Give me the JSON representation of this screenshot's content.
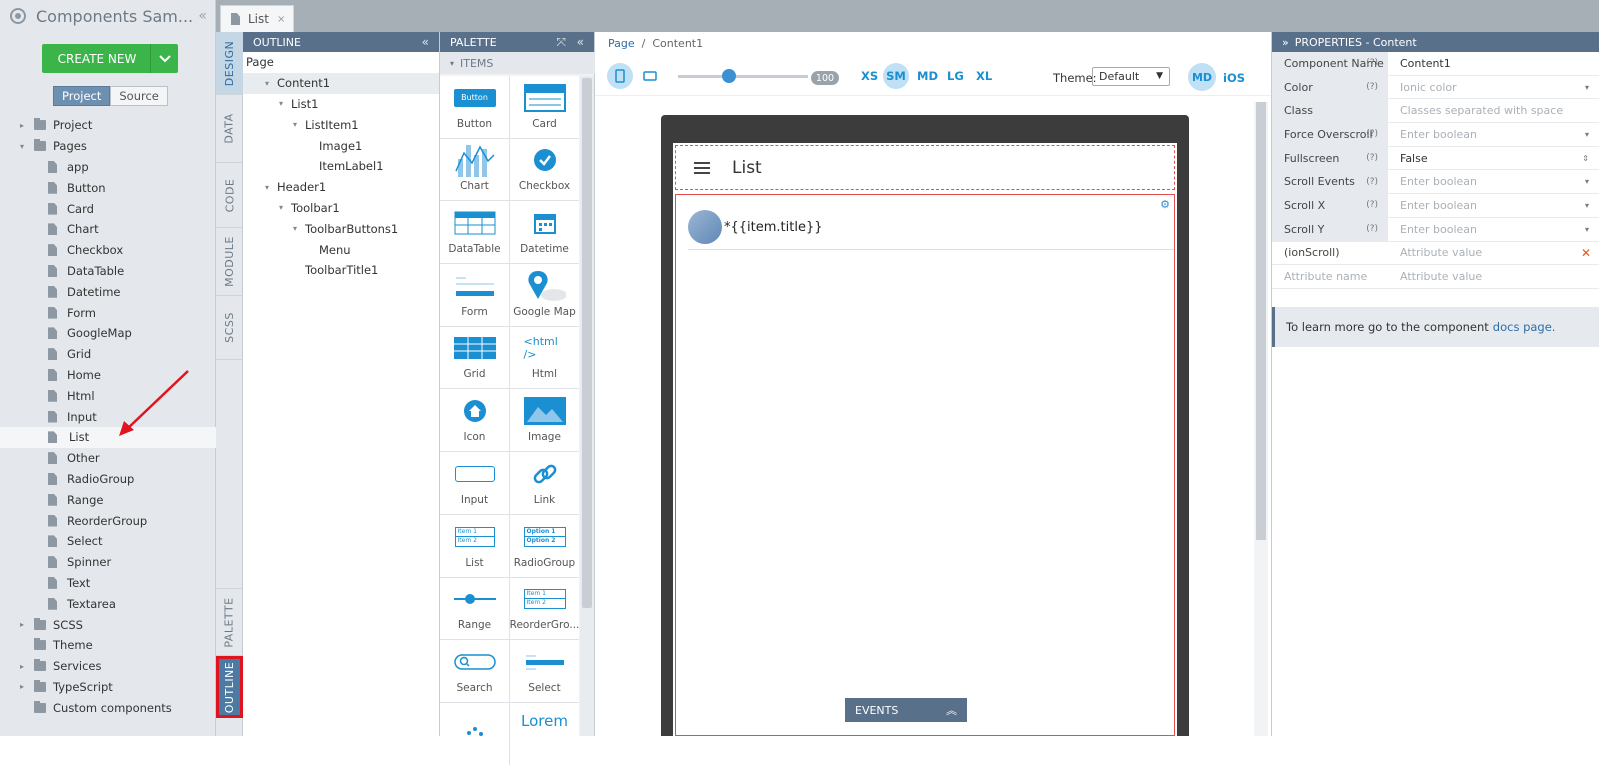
{
  "project": {
    "title": "Components Sam...",
    "create_label": "CREATE NEW",
    "tabs": [
      "Project",
      "Source"
    ],
    "tree": [
      {
        "label": "Project",
        "type": "folder",
        "level": 0,
        "toggle": "▸"
      },
      {
        "label": "Pages",
        "type": "folder",
        "level": 0,
        "toggle": "▾"
      },
      {
        "label": "app",
        "type": "page",
        "level": 1
      },
      {
        "label": "Button",
        "type": "page",
        "level": 1
      },
      {
        "label": "Card",
        "type": "page",
        "level": 1
      },
      {
        "label": "Chart",
        "type": "page",
        "level": 1
      },
      {
        "label": "Checkbox",
        "type": "page",
        "level": 1
      },
      {
        "label": "DataTable",
        "type": "page",
        "level": 1
      },
      {
        "label": "Datetime",
        "type": "page",
        "level": 1
      },
      {
        "label": "Form",
        "type": "page",
        "level": 1
      },
      {
        "label": "GoogleMap",
        "type": "page",
        "level": 1
      },
      {
        "label": "Grid",
        "type": "page",
        "level": 1
      },
      {
        "label": "Home",
        "type": "page",
        "level": 1
      },
      {
        "label": "Html",
        "type": "page",
        "level": 1
      },
      {
        "label": "Input",
        "type": "page",
        "level": 1
      },
      {
        "label": "List",
        "type": "page",
        "level": 1,
        "selected": true
      },
      {
        "label": "Other",
        "type": "page",
        "level": 1
      },
      {
        "label": "RadioGroup",
        "type": "page",
        "level": 1
      },
      {
        "label": "Range",
        "type": "page",
        "level": 1
      },
      {
        "label": "ReorderGroup",
        "type": "page",
        "level": 1
      },
      {
        "label": "Select",
        "type": "page",
        "level": 1
      },
      {
        "label": "Spinner",
        "type": "page",
        "level": 1
      },
      {
        "label": "Text",
        "type": "page",
        "level": 1
      },
      {
        "label": "Textarea",
        "type": "page",
        "level": 1
      },
      {
        "label": "SCSS",
        "type": "folder",
        "level": 0,
        "toggle": "▸"
      },
      {
        "label": "Theme",
        "type": "folder",
        "level": 0,
        "toggle": ""
      },
      {
        "label": "Services",
        "type": "folder",
        "level": 0,
        "toggle": "▸"
      },
      {
        "label": "TypeScript",
        "type": "folder",
        "level": 0,
        "toggle": "▸"
      },
      {
        "label": "Custom components",
        "type": "folder",
        "level": 0,
        "toggle": ""
      }
    ]
  },
  "side_tabs": [
    "DESIGN",
    "DATA",
    "CODE",
    "MODULE",
    "SCSS",
    "PALETTE",
    "OUTLINE"
  ],
  "editor_tab": {
    "label": "List",
    "close": "×"
  },
  "outline": {
    "title": "OUTLINE",
    "items": [
      {
        "label": "Page",
        "level": 0,
        "toggle": ""
      },
      {
        "label": "Content1",
        "level": 1,
        "toggle": "▾",
        "selected": true
      },
      {
        "label": "List1",
        "level": 2,
        "toggle": "▾"
      },
      {
        "label": "ListItem1",
        "level": 3,
        "toggle": "▾"
      },
      {
        "label": "Image1",
        "level": 4,
        "toggle": ""
      },
      {
        "label": "ItemLabel1",
        "level": 4,
        "toggle": ""
      },
      {
        "label": "Header1",
        "level": 1,
        "toggle": "▾"
      },
      {
        "label": "Toolbar1",
        "level": 2,
        "toggle": "▾"
      },
      {
        "label": "ToolbarButtons1",
        "level": 3,
        "toggle": "▾"
      },
      {
        "label": "Menu",
        "level": 4,
        "toggle": ""
      },
      {
        "label": "ToolbarTitle1",
        "level": 3,
        "toggle": ""
      }
    ]
  },
  "palette": {
    "title": "PALETTE",
    "section": "ITEMS",
    "items": [
      "Button",
      "Card",
      "Chart",
      "Checkbox",
      "DataTable",
      "Datetime",
      "Form",
      "Google Map",
      "Grid",
      "Html",
      "Icon",
      "Image",
      "Input",
      "Link",
      "List",
      "RadioGroup",
      "Range",
      "ReorderGro...",
      "Search",
      "Select",
      "",
      ""
    ],
    "icon_text": {
      "button": "Button",
      "html": "<html />",
      "lorem": "Lorem",
      "opt1": "Option 1",
      "opt2": "Option 2",
      "item1": "Item 1",
      "item2": "Item 2"
    }
  },
  "canvas": {
    "breadcrumb": {
      "page": "Page",
      "sep": "/",
      "current": "Content1"
    },
    "zoom": "100",
    "breakpoints": [
      "XS",
      "SM",
      "MD",
      "LG",
      "XL"
    ],
    "active_breakpoint": "SM",
    "theme_label": "Theme:",
    "theme_value": "Default",
    "mode_md": "MD",
    "mode_ios": "iOS",
    "header_title": "List",
    "item_text": "*{{item.title}}",
    "events_label": "EVENTS"
  },
  "properties": {
    "title": "PROPERTIES - Content",
    "rows": [
      {
        "key": "Component Name",
        "help": "(?)",
        "value": "Content1",
        "dark": true,
        "dd": ""
      },
      {
        "key": "Color",
        "help": "(?)",
        "value": "Ionic color",
        "dark": false,
        "dd": "▾"
      },
      {
        "key": "Class",
        "help": "",
        "value": "Classes separated with space",
        "dark": false,
        "dd": ""
      },
      {
        "key": "Force Overscroll",
        "help": "(?)",
        "value": "Enter boolean",
        "dark": false,
        "dd": "▾"
      },
      {
        "key": "Fullscreen",
        "help": "(?)",
        "value": "False",
        "dark": true,
        "dd": "⇕"
      },
      {
        "key": "Scroll Events",
        "help": "(?)",
        "value": "Enter boolean",
        "dark": false,
        "dd": "▾"
      },
      {
        "key": "Scroll X",
        "help": "(?)",
        "value": "Enter boolean",
        "dark": false,
        "dd": "▾"
      },
      {
        "key": "Scroll Y",
        "help": "(?)",
        "value": "Enter boolean",
        "dark": false,
        "dd": "▾"
      },
      {
        "key": "(ionScroll)",
        "help": "",
        "value": "Attribute value",
        "dark": false,
        "dd": "",
        "remove": "✕"
      },
      {
        "key": "Attribute name",
        "help": "",
        "value": "Attribute value",
        "dark": false,
        "dd": ""
      }
    ],
    "info_text": "To learn more go to the component",
    "info_link": "docs page."
  },
  "colors": {
    "accent": "#1a8fd1",
    "header": "#58708a",
    "create": "#3bb44a",
    "highlight": "#e0141e"
  }
}
